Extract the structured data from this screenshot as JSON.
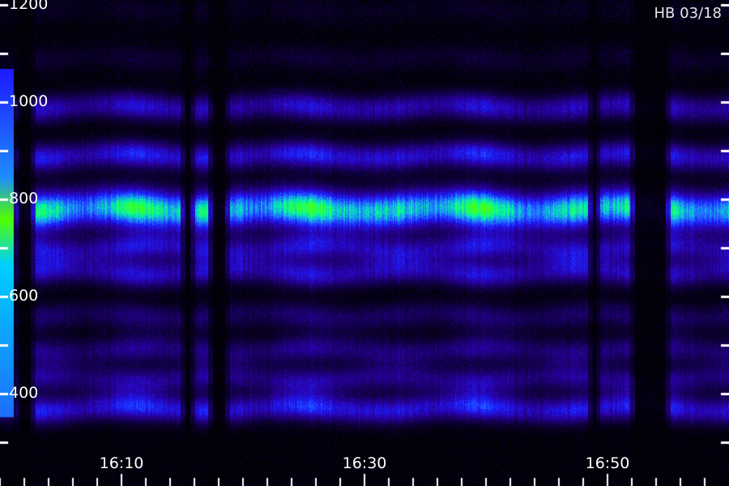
{
  "chart_data": {
    "type": "heatmap",
    "title": "",
    "xlabel": "",
    "ylabel": "",
    "annotation": "HB 03/18",
    "x": {
      "kind": "time",
      "ticks": [
        "16:10",
        "16:30",
        "16:50"
      ],
      "range": [
        "16:00",
        "16:59"
      ],
      "minor_tick_minutes": 2
    },
    "y": {
      "ticks": [
        400,
        600,
        800,
        1000,
        1200
      ],
      "range": [
        300,
        1200
      ],
      "minor_tick_step": 100
    },
    "colorscale": [
      "#000000",
      "#12004a",
      "#2a00a0",
      "#1d1dff",
      "#1e8cff",
      "#00ffa0",
      "#50ff00"
    ],
    "bands": [
      {
        "center": 370,
        "intensity": 0.52
      },
      {
        "center": 430,
        "intensity": 0.34
      },
      {
        "center": 490,
        "intensity": 0.3
      },
      {
        "center": 560,
        "intensity": 0.24
      },
      {
        "center": 650,
        "intensity": 0.42
      },
      {
        "center": 700,
        "intensity": 0.42
      },
      {
        "center": 780,
        "intensity": 0.95
      },
      {
        "center": 890,
        "intensity": 0.5
      },
      {
        "center": 990,
        "intensity": 0.42
      },
      {
        "center": 1090,
        "intensity": 0.1
      },
      {
        "center": 1190,
        "intensity": 0.07
      }
    ],
    "dropouts": [
      {
        "start": "16:01.5",
        "end": "16:02.5"
      },
      {
        "start": "16:15.2",
        "end": "16:15.6"
      },
      {
        "start": "16:17.5",
        "end": "16:18.5"
      },
      {
        "start": "16:48.8",
        "end": "16:49.0"
      },
      {
        "start": "16:52.2",
        "end": "16:54.8"
      }
    ],
    "grid": false
  }
}
